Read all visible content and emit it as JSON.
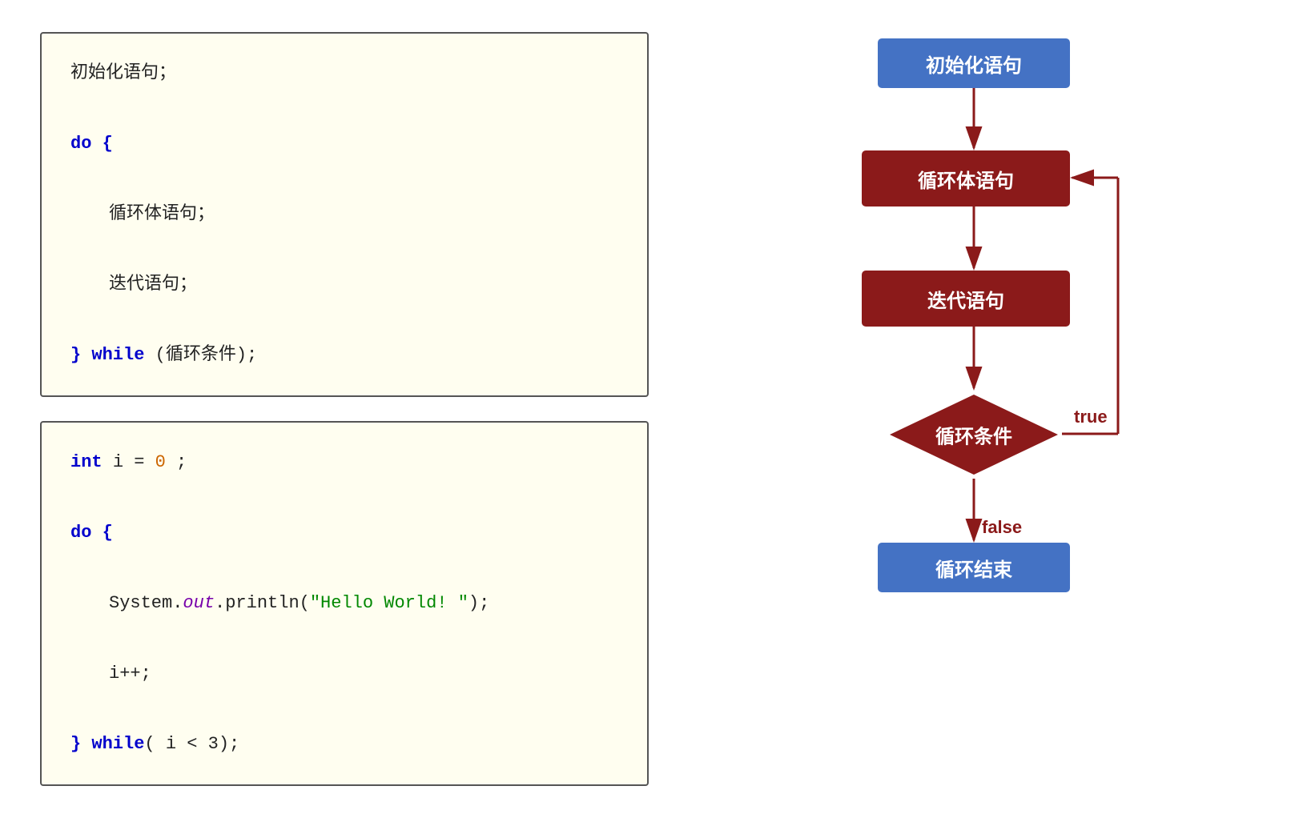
{
  "code_box_1": {
    "lines": [
      {
        "indent": 0,
        "parts": [
          {
            "text": "初始化语句；",
            "style": "text-black"
          }
        ]
      },
      {
        "indent": 0,
        "parts": []
      },
      {
        "indent": 0,
        "parts": [
          {
            "text": "do {",
            "style": "kw-blue"
          }
        ]
      },
      {
        "indent": 0,
        "parts": []
      },
      {
        "indent": 1,
        "parts": [
          {
            "text": "循环体语句；",
            "style": "text-black"
          }
        ]
      },
      {
        "indent": 0,
        "parts": []
      },
      {
        "indent": 1,
        "parts": [
          {
            "text": "迭代语句；",
            "style": "text-black"
          }
        ]
      },
      {
        "indent": 0,
        "parts": []
      },
      {
        "indent": 0,
        "parts": [
          {
            "text": "} ",
            "style": "kw-blue"
          },
          {
            "text": "while",
            "style": "kw-blue"
          },
          {
            "text": " (循环条件);",
            "style": "text-black"
          }
        ]
      }
    ]
  },
  "code_box_2": {
    "lines": [
      {
        "indent": 0,
        "parts": [
          {
            "text": "int",
            "style": "kw-blue"
          },
          {
            "text": " i = ",
            "style": "text-black"
          },
          {
            "text": "0",
            "style": "kw-orange"
          },
          {
            "text": ";",
            "style": "text-black"
          }
        ]
      },
      {
        "indent": 0,
        "parts": []
      },
      {
        "indent": 0,
        "parts": [
          {
            "text": "do {",
            "style": "kw-blue"
          }
        ]
      },
      {
        "indent": 0,
        "parts": []
      },
      {
        "indent": 1,
        "parts": [
          {
            "text": "System.",
            "style": "text-black"
          },
          {
            "text": "out",
            "style": "kw-purple"
          },
          {
            "text": ".println(",
            "style": "text-black"
          },
          {
            "text": "\"Hello World! \"",
            "style": "text-green"
          },
          {
            "text": ");",
            "style": "text-black"
          }
        ]
      },
      {
        "indent": 0,
        "parts": []
      },
      {
        "indent": 1,
        "parts": [
          {
            "text": "i++;",
            "style": "text-black"
          }
        ]
      },
      {
        "indent": 0,
        "parts": []
      },
      {
        "indent": 0,
        "parts": [
          {
            "text": "} ",
            "style": "kw-blue"
          },
          {
            "text": "while",
            "style": "kw-blue"
          },
          {
            "text": "( i < 3);",
            "style": "text-black"
          }
        ]
      }
    ]
  },
  "flowchart": {
    "nodes": {
      "init": {
        "label": "初始化语句"
      },
      "loop_body": {
        "label": "循环体语句"
      },
      "iter": {
        "label": "迭代语句"
      },
      "condition": {
        "label": "循环条件"
      },
      "end": {
        "label": "循环结束"
      }
    },
    "labels": {
      "true": "true",
      "false": "false"
    },
    "colors": {
      "blue": "#4472c4",
      "red": "#8b1a1a",
      "arrow": "#8b1a1a"
    }
  }
}
